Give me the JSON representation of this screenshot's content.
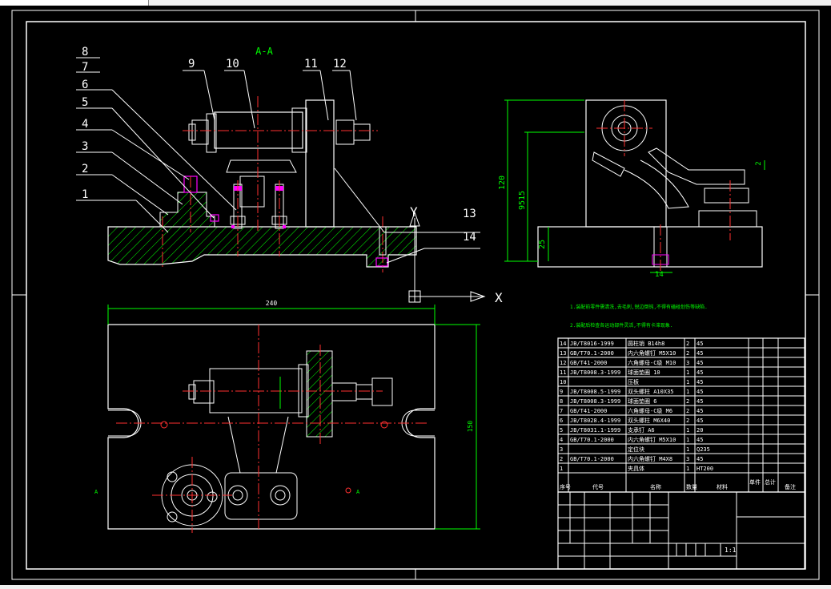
{
  "section_label": "A-A",
  "balloons": [
    "1",
    "2",
    "3",
    "4",
    "5",
    "6",
    "7",
    "8",
    "9",
    "10",
    "11",
    "12",
    "13",
    "14"
  ],
  "ucs": {
    "x_label": "X",
    "y_label": "Y"
  },
  "dims": {
    "width_240": "240",
    "height_150": "150",
    "height_120": "120",
    "height_9515": "9515",
    "height_25": "25",
    "small_2": "2",
    "small_14": "14"
  },
  "section_marks": {
    "left": "A",
    "right": "A"
  },
  "notes": [
    "1.装配前零件需清洗,去毛刺,锐边倒钝,不得有磕碰划伤等缺陷.",
    "2.装配后检查各运动部件灵活,不得有卡滞现象."
  ],
  "bom": [
    {
      "no": "14",
      "code": "JB/T8016-1999",
      "name": "圆柱销 B14h8",
      "qty": "2",
      "mat": "45"
    },
    {
      "no": "13",
      "code": "GB/T70.1-2000",
      "name": "内六角螺钉 M5X10",
      "qty": "2",
      "mat": "45"
    },
    {
      "no": "12",
      "code": "GB/T41-2000",
      "name": "六角螺母-C级 M10",
      "qty": "3",
      "mat": "45"
    },
    {
      "no": "11",
      "code": "JB/T8008.3-1999",
      "name": "球面垫圈 10",
      "qty": "1",
      "mat": "45"
    },
    {
      "no": "10",
      "code": "",
      "name": "压板",
      "qty": "1",
      "mat": "45"
    },
    {
      "no": "9",
      "code": "JB/T8008.5-1999",
      "name": "双头螺柱 A10X35",
      "qty": "1",
      "mat": "45"
    },
    {
      "no": "8",
      "code": "JB/T8008.3-1999",
      "name": "球面垫圈 6",
      "qty": "2",
      "mat": "45"
    },
    {
      "no": "7",
      "code": "GB/T41-2000",
      "name": "六角螺母-C级 M6",
      "qty": "2",
      "mat": "45"
    },
    {
      "no": "6",
      "code": "JB/T8028.4-1999",
      "name": "双头螺柱 M6X40",
      "qty": "2",
      "mat": "45"
    },
    {
      "no": "5",
      "code": "JB/T8031.1-1999",
      "name": "支承钉 A6",
      "qty": "1",
      "mat": "20"
    },
    {
      "no": "4",
      "code": "GB/T70.1-2000",
      "name": "内六角螺钉 M5X10",
      "qty": "1",
      "mat": "45"
    },
    {
      "no": "3",
      "code": "",
      "name": "定位块",
      "qty": "1",
      "mat": "Q235"
    },
    {
      "no": "2",
      "code": "GB/T70.1-2000",
      "name": "内六角螺钉 M4X8",
      "qty": "3",
      "mat": "45"
    },
    {
      "no": "1",
      "code": "",
      "name": "夹具体",
      "qty": "1",
      "mat": "HT200"
    }
  ],
  "bom_header": {
    "no": "序号",
    "code": "代号",
    "name": "名称",
    "qty": "数量",
    "mat": "材料",
    "unit_w": "单件",
    "total_w": "总计",
    "note": "备注"
  },
  "title_block": {
    "scale_value": "1:1"
  },
  "colors": {
    "lines": "#ffffff",
    "centerline": "#ff3030",
    "dimension": "#00ff00",
    "hatch": "#00ff00",
    "fastener": "#ff00ff",
    "balloon": "#ffffff"
  }
}
